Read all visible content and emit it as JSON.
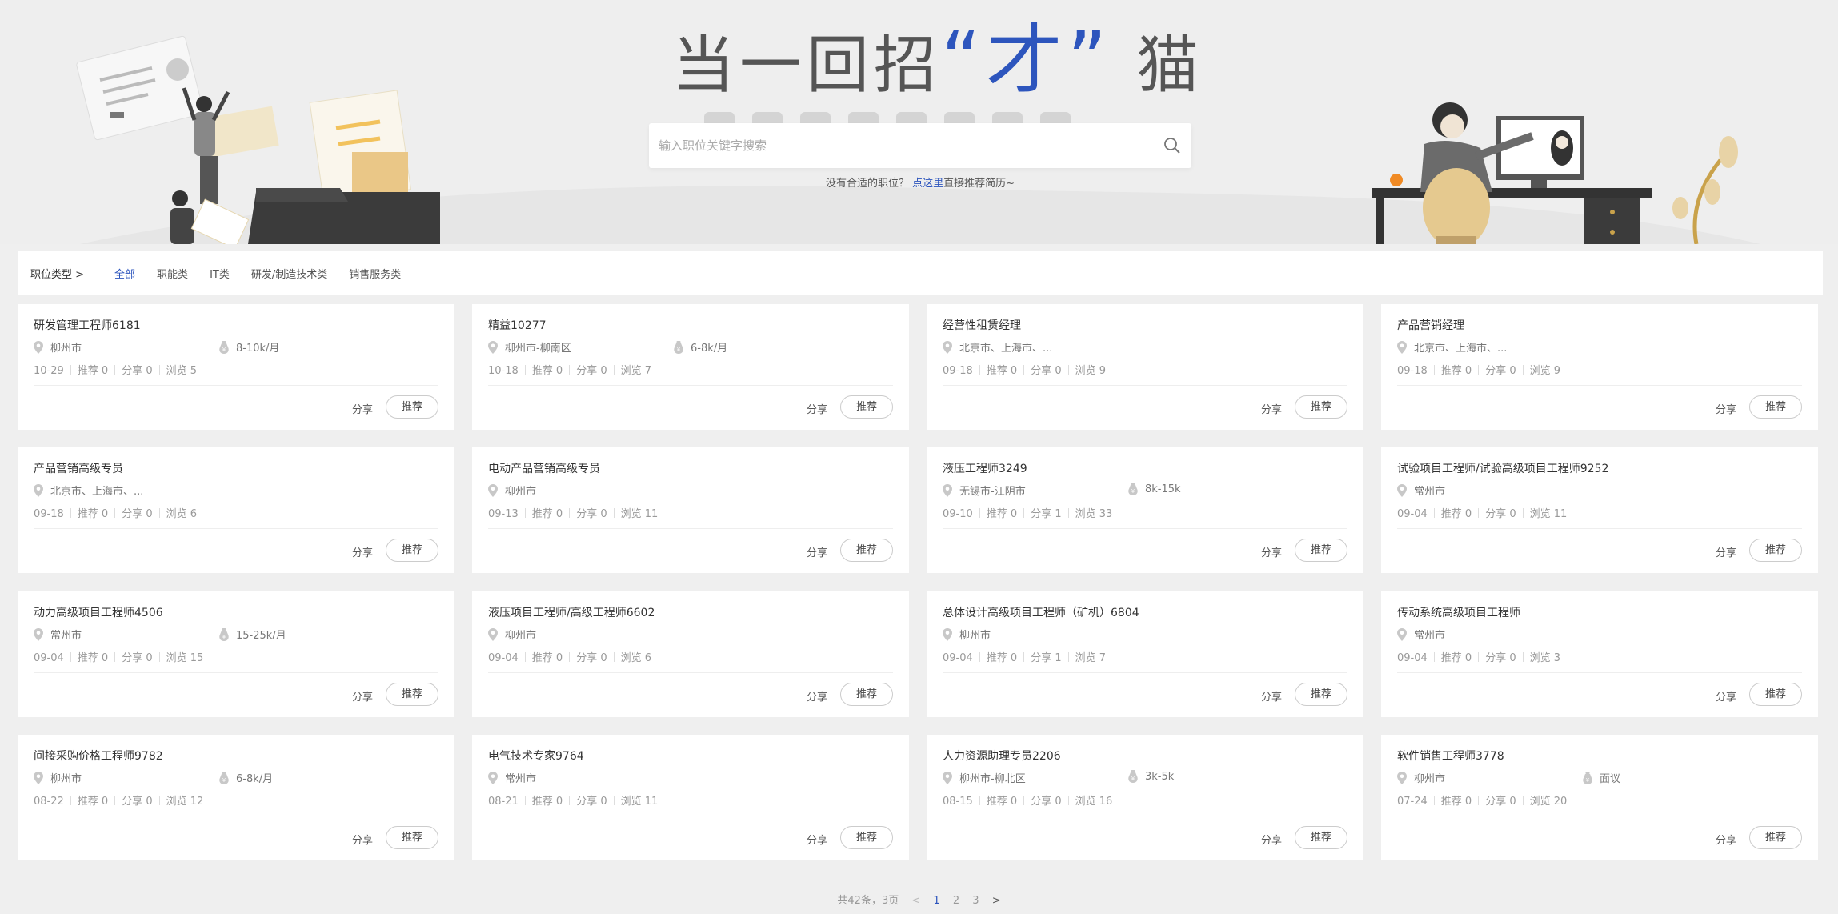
{
  "hero": {
    "slogan_pre": "当一回招",
    "slogan_hl": "“才”",
    "slogan_post": "猫",
    "search_placeholder": "输入职位关键字搜索",
    "hint_pre": "没有合适的职位？",
    "hint_link": "点这里",
    "hint_post": "直接推荐简历~",
    "accent_color": "#2d55bd"
  },
  "filter": {
    "label": "职位类型  >",
    "items": [
      {
        "label": "全部",
        "active": true
      },
      {
        "label": "职能类",
        "active": false
      },
      {
        "label": "IT类",
        "active": false
      },
      {
        "label": "研发/制造技术类",
        "active": false
      },
      {
        "label": "销售服务类",
        "active": false
      }
    ]
  },
  "actions": {
    "share": "分享",
    "recommend": "推荐"
  },
  "jobs": [
    {
      "title": "研发管理工程师6181",
      "location": "柳州市",
      "salary": "8-10k/月",
      "date": "10-29",
      "recommend": "推荐 0",
      "share": "分享 0",
      "views": "浏览 5"
    },
    {
      "title": "精益10277",
      "location": "柳州市-柳南区",
      "salary": "6-8k/月",
      "date": "10-18",
      "recommend": "推荐 0",
      "share": "分享 0",
      "views": "浏览 7"
    },
    {
      "title": "经营性租赁经理",
      "location": "北京市、上海市、...",
      "salary": "",
      "date": "09-18",
      "recommend": "推荐 0",
      "share": "分享 0",
      "views": "浏览 9"
    },
    {
      "title": "产品营销经理",
      "location": "北京市、上海市、...",
      "salary": "",
      "date": "09-18",
      "recommend": "推荐 0",
      "share": "分享 0",
      "views": "浏览 9"
    },
    {
      "title": "产品营销高级专员",
      "location": "北京市、上海市、...",
      "salary": "",
      "date": "09-18",
      "recommend": "推荐 0",
      "share": "分享 0",
      "views": "浏览 6"
    },
    {
      "title": "电动产品营销高级专员",
      "location": "柳州市",
      "salary": "",
      "date": "09-13",
      "recommend": "推荐 0",
      "share": "分享 0",
      "views": "浏览 11"
    },
    {
      "title": "液压工程师3249",
      "location": "无锡市-江阴市",
      "salary": "8k-15k",
      "date": "09-10",
      "recommend": "推荐 0",
      "share": "分享 1",
      "views": "浏览 33"
    },
    {
      "title": "试验项目工程师/试验高级项目工程师9252",
      "location": "常州市",
      "salary": "",
      "date": "09-04",
      "recommend": "推荐 0",
      "share": "分享 0",
      "views": "浏览 11"
    },
    {
      "title": "动力高级项目工程师4506",
      "location": "常州市",
      "salary": "15-25k/月",
      "date": "09-04",
      "recommend": "推荐 0",
      "share": "分享 0",
      "views": "浏览 15"
    },
    {
      "title": "液压项目工程师/高级工程师6602",
      "location": "柳州市",
      "salary": "",
      "date": "09-04",
      "recommend": "推荐 0",
      "share": "分享 0",
      "views": "浏览 6"
    },
    {
      "title": "总体设计高级项目工程师（矿机）6804",
      "location": "柳州市",
      "salary": "",
      "date": "09-04",
      "recommend": "推荐 0",
      "share": "分享 1",
      "views": "浏览 7"
    },
    {
      "title": "传动系统高级项目工程师",
      "location": "常州市",
      "salary": "",
      "date": "09-04",
      "recommend": "推荐 0",
      "share": "分享 0",
      "views": "浏览 3"
    },
    {
      "title": "间接采购价格工程师9782",
      "location": "柳州市",
      "salary": "6-8k/月",
      "date": "08-22",
      "recommend": "推荐 0",
      "share": "分享 0",
      "views": "浏览 12"
    },
    {
      "title": "电气技术专家9764",
      "location": "常州市",
      "salary": "",
      "date": "08-21",
      "recommend": "推荐 0",
      "share": "分享 0",
      "views": "浏览 11"
    },
    {
      "title": "人力资源助理专员2206",
      "location": "柳州市-柳北区",
      "salary": "3k-5k",
      "date": "08-15",
      "recommend": "推荐 0",
      "share": "分享 0",
      "views": "浏览 16"
    },
    {
      "title": "软件销售工程师3778",
      "location": "柳州市",
      "salary": "面议",
      "date": "07-24",
      "recommend": "推荐 0",
      "share": "分享 0",
      "views": "浏览 20"
    }
  ],
  "pagination": {
    "summary": "共42条，3页",
    "prev": "<",
    "pages": [
      "1",
      "2",
      "3"
    ],
    "current": "1",
    "next": ">"
  }
}
